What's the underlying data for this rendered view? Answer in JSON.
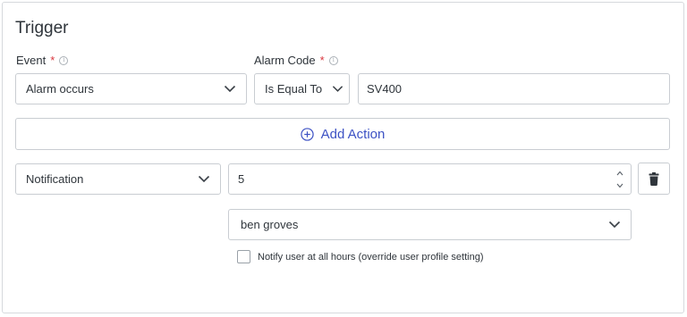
{
  "trigger": {
    "title": "Trigger",
    "event_label": "Event",
    "alarm_code_label": "Alarm Code",
    "required_marker": "*",
    "event_value": "Alarm occurs",
    "operator_value": "Is Equal To",
    "alarm_code_value": "SV400"
  },
  "actions": {
    "add_label": "Add Action",
    "type_value": "Notification",
    "number_value": "5",
    "user_value": "ben groves",
    "notify_all_hours_label": "Notify user at all hours (override user profile setting)",
    "notify_all_hours_checked": false
  },
  "colors": {
    "accent": "#3d52c4",
    "required": "#d9363e",
    "border": "#c9cdd2"
  }
}
